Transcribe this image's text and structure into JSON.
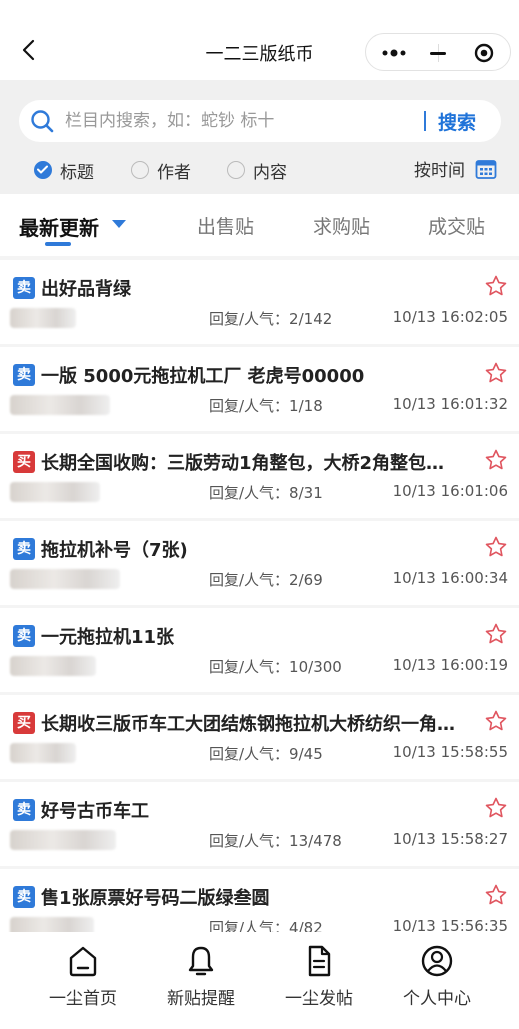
{
  "nav": {
    "title": "一二三版纸币"
  },
  "search": {
    "placeholder": "栏目内搜索，如：蛇钞 标十",
    "button": "搜索"
  },
  "filters": {
    "title": "标题",
    "author": "作者",
    "content": "内容",
    "sort": "按时间"
  },
  "tabs": {
    "latest": "最新更新",
    "sell": "出售贴",
    "buy": "求购贴",
    "done": "成交贴"
  },
  "posts": [
    {
      "tag": "卖",
      "title": "出好品背绿",
      "stats": "回复/人气：2/142",
      "time": "10/13 16:02:05"
    },
    {
      "tag": "卖",
      "title": "一版 5000元拖拉机工厂 老虎号00000",
      "stats": "回复/人气：1/18",
      "time": "10/13 16:01:32"
    },
    {
      "tag": "买",
      "title": "长期全国收购：三版劳动1角整包，大桥2角整包，纺…",
      "stats": "回复/人气：8/31",
      "time": "10/13 16:01:06"
    },
    {
      "tag": "卖",
      "title": "拖拉机补号（7张)",
      "stats": "回复/人气：2/69",
      "time": "10/13 16:00:34"
    },
    {
      "tag": "卖",
      "title": "一元拖拉机11张",
      "stats": "回复/人气：10/300",
      "time": "10/13 16:00:19"
    },
    {
      "tag": "买",
      "title": "长期收三版币车工大团结炼钢拖拉机大桥纺织一角五…",
      "stats": "回复/人气：9/45",
      "time": "10/13 15:58:55"
    },
    {
      "tag": "卖",
      "title": "好号古币车工",
      "stats": "回复/人气：13/478",
      "time": "10/13 15:58:27"
    },
    {
      "tag": "卖",
      "title": "售1张原票好号码二版绿叁圆",
      "stats": "回复/人气：4/82",
      "time": "10/13 15:56:35"
    }
  ],
  "tabbar": {
    "home": "一尘首页",
    "alerts": "新贴提醒",
    "post": "一尘发帖",
    "me": "个人中心"
  },
  "colors": {
    "accent": "#2f7ad9",
    "sell": "#2f7ad9",
    "buy": "#d83a3a"
  }
}
